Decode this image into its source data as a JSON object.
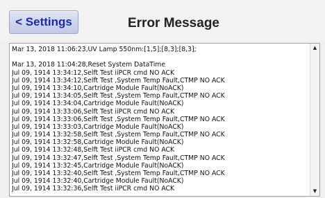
{
  "header": {
    "back_label": "< Settings",
    "title": "Error Message"
  },
  "log": {
    "lines": [
      "Mar 13, 2018  11:06:23,UV Lamp 550nm:[1,5];[8,3];[8,3];",
      "",
      "Mar 13, 2018  11:04:28,Reset System DataTime",
      "Jul 09, 1914  13:34:12,Selft Test iiPCR cmd NO ACK",
      "Jul 09, 1914  13:34:12,Selft Test ,System Temp Fault,CTMP NO ACK",
      "Jul 09, 1914  13:34:10,Cartridge Module Fault(NoACK)",
      "Jul 09, 1914  13:34:05,Selft Test ,System Temp Fault,CTMP NO ACK",
      "Jul 09, 1914  13:34:04,Cartridge Module Fault(NoACK)",
      "Jul 09, 1914  13:33:06,Selft Test iiPCR cmd NO ACK",
      "Jul 09, 1914  13:33:06,Selft Test ,System Temp Fault,CTMP NO ACK",
      "Jul 09, 1914  13:33:03,Cartridge Module Fault(NoACK)",
      "Jul 09, 1914  13:32:58,Selft Test ,System Temp Fault,CTMP NO ACK",
      "Jul 09, 1914  13:32:58,Cartridge Module Fault(NoACK)",
      "Jul 09, 1914  13:32:48,Selft Test iiPCR cmd NO ACK",
      "Jul 09, 1914  13:32:47,Selft Test ,System Temp Fault,CTMP NO ACK",
      "Jul 09, 1914  13:32:45,Cartridge Module Fault(NoACK)",
      "Jul 09, 1914  13:32:40,Selft Test ,System Temp Fault,CTMP NO ACK",
      "Jul 09, 1914  13:32:40,Cartridge Module Fault(NoACK)",
      "Jul 09, 1914  13:32:36,Selft Test iiPCR cmd NO ACK"
    ]
  },
  "scrollbar": {
    "up_glyph": "▲",
    "down_glyph": "▼"
  }
}
